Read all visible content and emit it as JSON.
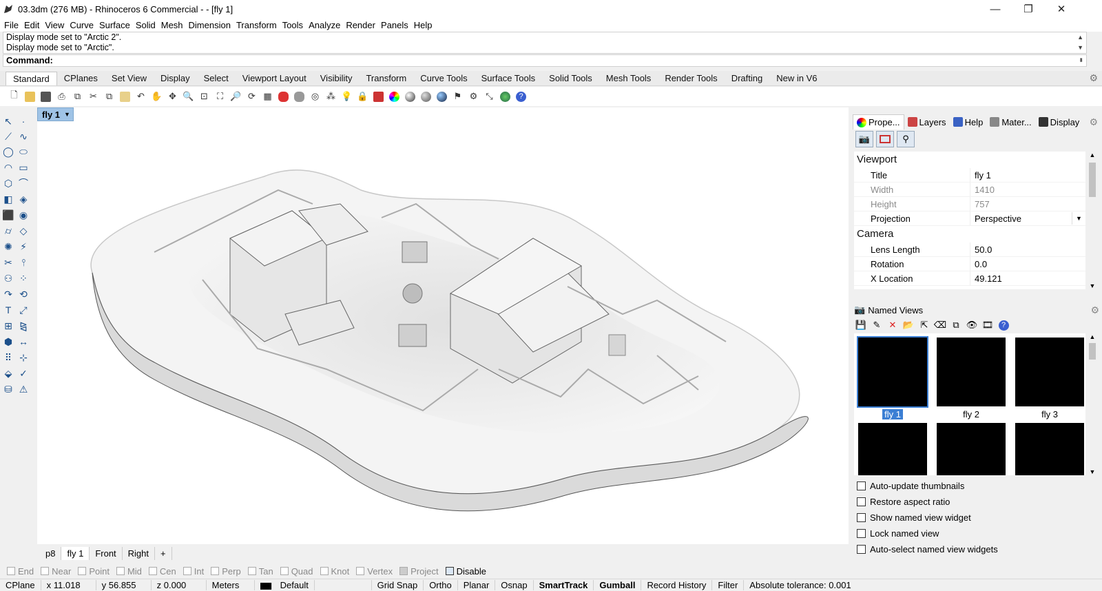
{
  "window": {
    "title": "03.3dm (276 MB) - Rhinoceros 6 Commercial - - [fly 1]",
    "minimize_glyph": "—",
    "maximize_glyph": "❐",
    "close_glyph": "✕"
  },
  "menu": [
    "File",
    "Edit",
    "View",
    "Curve",
    "Surface",
    "Solid",
    "Mesh",
    "Dimension",
    "Transform",
    "Tools",
    "Analyze",
    "Render",
    "Panels",
    "Help"
  ],
  "command_history": [
    "Display mode set to \"Arctic 2\".",
    "Display mode set to \"Arctic\"."
  ],
  "command_prompt": "Command:",
  "toolbar_tabs": [
    "Standard",
    "CPlanes",
    "Set View",
    "Display",
    "Select",
    "Viewport Layout",
    "Visibility",
    "Transform",
    "Curve Tools",
    "Surface Tools",
    "Solid Tools",
    "Mesh Tools",
    "Render Tools",
    "Drafting",
    "New in V6"
  ],
  "viewport": {
    "active_title": "fly 1",
    "tabs": [
      "p8",
      "fly 1",
      "Front",
      "Right",
      "+"
    ]
  },
  "panel_tabs": [
    {
      "label": "Prope...",
      "icon": "properties-icon"
    },
    {
      "label": "Layers",
      "icon": "layers-icon"
    },
    {
      "label": "Help",
      "icon": "help-icon"
    },
    {
      "label": "Mater...",
      "icon": "materials-icon"
    },
    {
      "label": "Display",
      "icon": "display-icon"
    }
  ],
  "properties": {
    "viewport_section": "Viewport",
    "title_label": "Title",
    "title_value": "fly 1",
    "width_label": "Width",
    "width_value": "1410",
    "height_label": "Height",
    "height_value": "757",
    "projection_label": "Projection",
    "projection_value": "Perspective",
    "camera_section": "Camera",
    "lens_label": "Lens Length",
    "lens_value": "50.0",
    "rotation_label": "Rotation",
    "rotation_value": "0.0",
    "xloc_label": "X Location",
    "xloc_value": "49.121"
  },
  "named_views": {
    "header": "Named Views",
    "thumbnails": [
      "fly 1",
      "fly 2",
      "fly 3",
      "",
      "",
      ""
    ],
    "selected": "fly 1",
    "options": [
      "Auto-update thumbnails",
      "Restore aspect ratio",
      "Show named view widget",
      "Lock named view",
      "Auto-select named view widgets"
    ]
  },
  "osnaps": [
    "End",
    "Near",
    "Point",
    "Mid",
    "Cen",
    "Int",
    "Perp",
    "Tan",
    "Quad",
    "Knot",
    "Vertex",
    "Project"
  ],
  "osnap_disable": "Disable",
  "status": {
    "cplane": "CPlane",
    "x": "x 11.018",
    "y": "y 56.855",
    "z": "z 0.000",
    "units": "Meters",
    "layer": "Default",
    "grid_snap": "Grid Snap",
    "ortho": "Ortho",
    "planar": "Planar",
    "osnap": "Osnap",
    "smarttrack": "SmartTrack",
    "gumball": "Gumball",
    "record_history": "Record History",
    "filter": "Filter",
    "tolerance": "Absolute tolerance: 0.001"
  },
  "colors": {
    "accent": "#3b7fd4",
    "viewport_tab": "#9fc3e6"
  }
}
